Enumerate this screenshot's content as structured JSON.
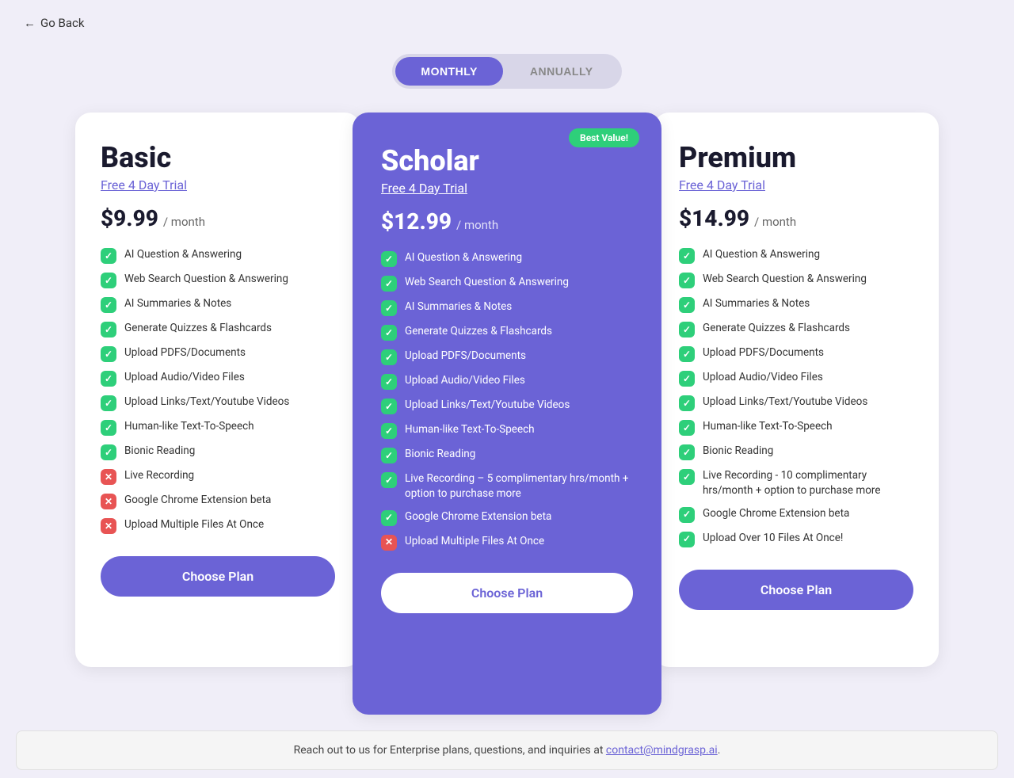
{
  "header": {
    "go_back_label": "Go Back",
    "go_back_arrow": "←"
  },
  "toggle": {
    "monthly_label": "MONTHLY",
    "annually_label": "ANNUALLY",
    "active": "monthly"
  },
  "plans": [
    {
      "id": "basic",
      "name": "Basic",
      "trial": "Free 4 Day Trial",
      "price": "$9.99",
      "period": "/ month",
      "best_value": false,
      "features": [
        {
          "text": "AI Question & Answering",
          "included": true
        },
        {
          "text": "Web Search Question & Answering",
          "included": true
        },
        {
          "text": "AI Summaries & Notes",
          "included": true
        },
        {
          "text": "Generate Quizzes & Flashcards",
          "included": true
        },
        {
          "text": "Upload PDFS/Documents",
          "included": true
        },
        {
          "text": "Upload Audio/Video Files",
          "included": true
        },
        {
          "text": "Upload Links/Text/Youtube Videos",
          "included": true
        },
        {
          "text": "Human-like Text-To-Speech",
          "included": true
        },
        {
          "text": "Bionic Reading",
          "included": true
        },
        {
          "text": "Live Recording",
          "included": false
        },
        {
          "text": "Google Chrome Extension beta",
          "included": false
        },
        {
          "text": "Upload Multiple Files At Once",
          "included": false
        }
      ],
      "cta": "Choose Plan"
    },
    {
      "id": "scholar",
      "name": "Scholar",
      "trial": "Free 4 Day Trial",
      "price": "$12.99",
      "period": "/ month",
      "best_value": true,
      "best_value_label": "Best Value!",
      "features": [
        {
          "text": "AI Question & Answering",
          "included": true
        },
        {
          "text": "Web Search Question & Answering",
          "included": true
        },
        {
          "text": "AI Summaries & Notes",
          "included": true
        },
        {
          "text": "Generate Quizzes & Flashcards",
          "included": true
        },
        {
          "text": "Upload PDFS/Documents",
          "included": true
        },
        {
          "text": "Upload Audio/Video Files",
          "included": true
        },
        {
          "text": "Upload Links/Text/Youtube Videos",
          "included": true
        },
        {
          "text": "Human-like Text-To-Speech",
          "included": true
        },
        {
          "text": "Bionic Reading",
          "included": true
        },
        {
          "text": "Live Recording – 5 complimentary hrs/month + option to purchase more",
          "included": true
        },
        {
          "text": "Google Chrome Extension beta",
          "included": true
        },
        {
          "text": "Upload Multiple Files At Once",
          "included": false
        }
      ],
      "cta": "Choose Plan"
    },
    {
      "id": "premium",
      "name": "Premium",
      "trial": "Free 4 Day Trial",
      "price": "$14.99",
      "period": "/ month",
      "best_value": false,
      "features": [
        {
          "text": "AI Question & Answering",
          "included": true
        },
        {
          "text": "Web Search Question & Answering",
          "included": true
        },
        {
          "text": "AI Summaries & Notes",
          "included": true
        },
        {
          "text": "Generate Quizzes & Flashcards",
          "included": true
        },
        {
          "text": "Upload PDFS/Documents",
          "included": true
        },
        {
          "text": "Upload Audio/Video Files",
          "included": true
        },
        {
          "text": "Upload Links/Text/Youtube Videos",
          "included": true
        },
        {
          "text": "Human-like Text-To-Speech",
          "included": true
        },
        {
          "text": "Bionic Reading",
          "included": true
        },
        {
          "text": "Live Recording - 10 complimentary hrs/month + option to purchase more",
          "included": true
        },
        {
          "text": "Google Chrome Extension beta",
          "included": true
        },
        {
          "text": "Upload Over 10 Files At Once!",
          "included": true
        }
      ],
      "cta": "Choose Plan"
    }
  ],
  "footer": {
    "text": "Reach out to us for Enterprise plans, questions, and inquiries at ",
    "link_text": "contact@mindgrasp.ai",
    "link_href": "mailto:contact@mindgrasp.ai",
    "suffix": "."
  }
}
